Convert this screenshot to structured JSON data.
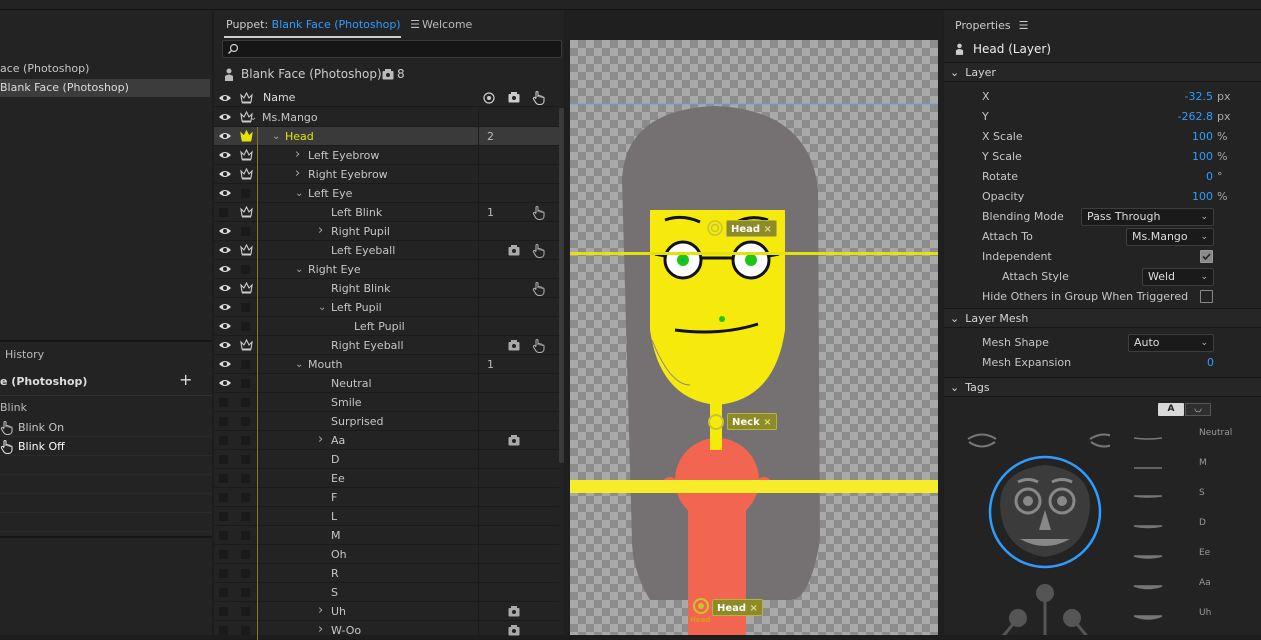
{
  "left_panel": {
    "items": [
      {
        "label": "ace (Photoshop)"
      },
      {
        "label": "Blank Face (Photoshop)"
      }
    ],
    "history": {
      "title": "History",
      "doc": "e (Photoshop)",
      "add_icon": "+",
      "group": "Blink",
      "items": [
        {
          "label": "Blink On"
        },
        {
          "label": "Blink Off"
        }
      ]
    }
  },
  "puppet_panel": {
    "tab_prefix": "Puppet: ",
    "tab_title": "Blank Face (Photoshop)",
    "tab_welcome": "Welcome",
    "puppet_name": "Blank Face (Photoshop)",
    "puppet_count": "8",
    "col_name": "Name",
    "rows": [
      {
        "name": "Ms.Mango",
        "twirl": "v",
        "num": ""
      },
      {
        "name": "Head",
        "twirl": "v",
        "num": "2"
      },
      {
        "name": "Left Eyebrow",
        "twirl": ">",
        "num": ""
      },
      {
        "name": "Right Eyebrow",
        "twirl": ">",
        "num": ""
      },
      {
        "name": "Left Eye",
        "twirl": "v",
        "num": ""
      },
      {
        "name": "Left Blink",
        "twirl": "",
        "num": "1"
      },
      {
        "name": "Right Pupil",
        "twirl": ">",
        "num": ""
      },
      {
        "name": "Left Eyeball",
        "twirl": "",
        "num": ""
      },
      {
        "name": "Right Eye",
        "twirl": "v",
        "num": ""
      },
      {
        "name": "Right Blink",
        "twirl": "",
        "num": ""
      },
      {
        "name": "Left Pupil",
        "twirl": "v",
        "num": ""
      },
      {
        "name": "Left Pupil",
        "twirl": "",
        "num": ""
      },
      {
        "name": "Right Eyeball",
        "twirl": "",
        "num": ""
      },
      {
        "name": "Mouth",
        "twirl": "v",
        "num": "1"
      },
      {
        "name": "Neutral",
        "twirl": "",
        "num": ""
      },
      {
        "name": "Smile",
        "twirl": "",
        "num": ""
      },
      {
        "name": "Surprised",
        "twirl": "",
        "num": ""
      },
      {
        "name": "Aa",
        "twirl": ">",
        "num": ""
      },
      {
        "name": "D",
        "twirl": "",
        "num": ""
      },
      {
        "name": "Ee",
        "twirl": "",
        "num": ""
      },
      {
        "name": "F",
        "twirl": "",
        "num": ""
      },
      {
        "name": "L",
        "twirl": "",
        "num": ""
      },
      {
        "name": "M",
        "twirl": "",
        "num": ""
      },
      {
        "name": "Oh",
        "twirl": "",
        "num": ""
      },
      {
        "name": "R",
        "twirl": "",
        "num": ""
      },
      {
        "name": "S",
        "twirl": "",
        "num": ""
      },
      {
        "name": "Uh",
        "twirl": ">",
        "num": ""
      },
      {
        "name": "W-Oo",
        "twirl": ">",
        "num": ""
      }
    ]
  },
  "canvas": {
    "handles": [
      {
        "label": "Head"
      },
      {
        "label": "Neck"
      },
      {
        "label": "Head"
      }
    ],
    "handle_caption": "Head",
    "close_glyph": "×"
  },
  "properties": {
    "title": "Properties",
    "layer_name": "Head (Layer)",
    "section_layer": "Layer",
    "x_label": "X",
    "x_value": "-32.5",
    "x_unit": "px",
    "y_label": "Y",
    "y_value": "-262.8",
    "y_unit": "px",
    "xscale_label": "X Scale",
    "xscale_value": "100",
    "xscale_unit": "%",
    "yscale_label": "Y Scale",
    "yscale_value": "100",
    "yscale_unit": "%",
    "rotate_label": "Rotate",
    "rotate_value": "0",
    "rotate_unit": "°",
    "opacity_label": "Opacity",
    "opacity_value": "100",
    "opacity_unit": "%",
    "blending_label": "Blending Mode",
    "blending_value": "Pass Through",
    "attach_label": "Attach To",
    "attach_value": "Ms.Mango",
    "independent_label": "Independent",
    "independent_checked": true,
    "attach_style_label": "Attach Style",
    "attach_style_value": "Weld",
    "hide_label": "Hide Others in Group When Triggered",
    "hide_checked": false,
    "section_mesh": "Layer Mesh",
    "mesh_shape_label": "Mesh Shape",
    "mesh_shape_value": "Auto",
    "mesh_exp_label": "Mesh Expansion",
    "mesh_exp_value": "0",
    "section_tags": "Tags",
    "tag_mode_a": "A",
    "visemes": [
      {
        "label": "Neutral"
      },
      {
        "label": "M"
      },
      {
        "label": "S"
      },
      {
        "label": "D"
      },
      {
        "label": "Ee"
      },
      {
        "label": "Aa"
      },
      {
        "label": "Uh"
      }
    ]
  },
  "colors": {
    "accent": "#2e9dff",
    "highlight": "#e7e10a",
    "face": "#f5ea0c",
    "hair": "#757172",
    "body": "#f26550",
    "pin": "#8d8b28"
  }
}
